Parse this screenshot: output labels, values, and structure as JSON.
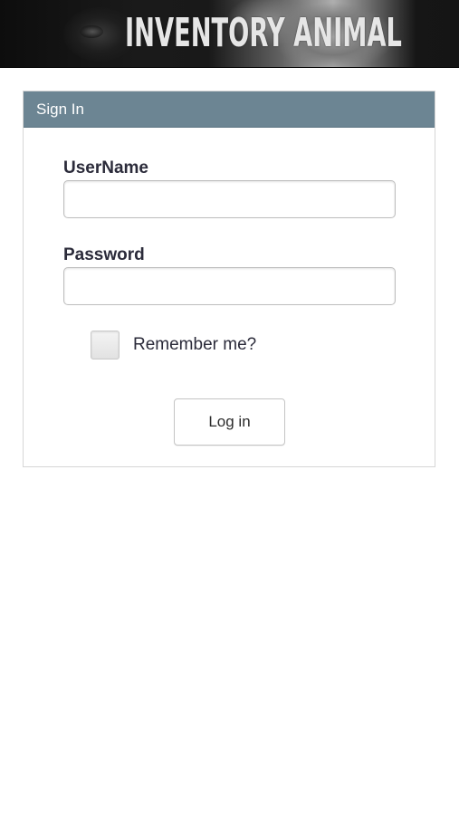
{
  "header": {
    "logo_text": "INVENTORY ANIMAL"
  },
  "signin": {
    "title": "Sign In",
    "username_label": "UserName",
    "username_value": "",
    "password_label": "Password",
    "password_value": "",
    "remember_label": "Remember me?",
    "remember_checked": false,
    "login_label": "Log in"
  },
  "colors": {
    "panel_heading": "#6c8593",
    "banner_background": "#111111"
  },
  "icons": {
    "logo": "animal-eye-logo-icon"
  }
}
